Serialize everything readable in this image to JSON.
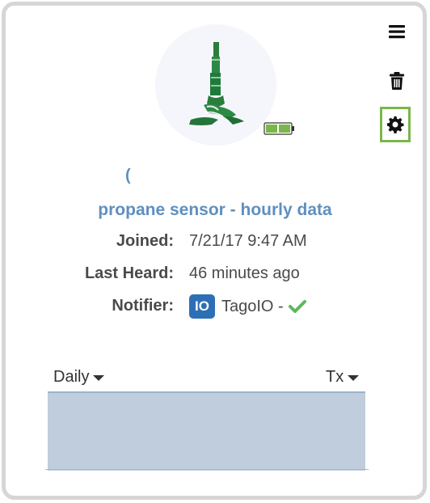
{
  "toolbar": {
    "menu_icon": "hamburger-menu-icon",
    "delete_icon": "trash-icon",
    "settings_icon": "gear-icon",
    "settings_highlight_color": "#7ab648"
  },
  "device": {
    "avatar_icon": "antenna-sensor-icon",
    "battery_icon": "battery-icon",
    "battery_color": "#7ab648",
    "short_name": "(",
    "name": "propane sensor - hourly data",
    "name_color": "#5f8fbf"
  },
  "info": {
    "joined_label": "Joined:",
    "joined_value": "7/21/17 9:47 AM",
    "last_heard_label": "Last Heard:",
    "last_heard_value": "46 minutes ago",
    "notifier_label": "Notifier:",
    "notifier_logo_text": "IO",
    "notifier_value": "TagoIO -",
    "notifier_status_icon": "checkmark-icon",
    "notifier_status_color": "#5cb85c"
  },
  "chart": {
    "period_select": "Daily",
    "metric_select": "Tx",
    "fill_color": "#bfcddc"
  }
}
